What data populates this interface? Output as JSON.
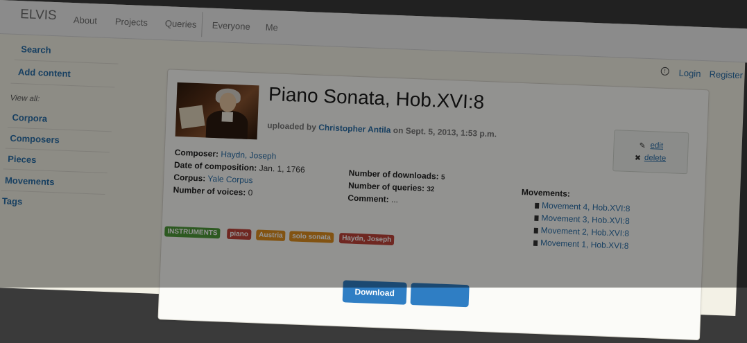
{
  "navbar": {
    "brand": "ELVIS",
    "links": [
      "About",
      "Projects",
      "Queries",
      "Everyone",
      "Me"
    ]
  },
  "sidebar": {
    "search": "Search",
    "add_content": "Add content",
    "view_all_heading": "View all:",
    "items": [
      "Corpora",
      "Composers",
      "Pieces",
      "Movements",
      "Tags"
    ]
  },
  "user_nav": {
    "icon": "user-circle-icon",
    "login": "Login",
    "register": "Register"
  },
  "piece": {
    "title": "Piano Sonata, Hob.XVI:8",
    "uploaded_prefix": "uploaded by",
    "uploader": "Christopher Antila",
    "uploaded_on": "on Sept. 5, 2013, 1:53 p.m.",
    "composer_label": "Composer:",
    "composer": "Haydn, Joseph",
    "date_label": "Date of composition:",
    "date": "Jan. 1, 1766",
    "corpus_label": "Corpus:",
    "corpus": "Yale Corpus",
    "voices_label": "Number of voices:",
    "voices": "0",
    "downloads_label": "Number of downloads:",
    "downloads": "5",
    "queries_label": "Number of queries:",
    "queries": "32",
    "comment_label": "Comment:",
    "comment": "...",
    "movements_label": "Movements:",
    "movements": [
      "Movement 4, Hob.XVI:8",
      "Movement 3, Hob.XVI:8",
      "Movement 2, Hob.XVI:8",
      "Movement 1, Hob.XVI:8"
    ]
  },
  "actions": {
    "edit": "edit",
    "delete": "delete",
    "edit_icon": "pencil-icon",
    "delete_icon": "x-icon"
  },
  "tags": [
    {
      "label": "INSTRUMENTS",
      "color": "#4e9a3a"
    },
    {
      "label": "piano",
      "color": "#c0443a"
    },
    {
      "label": "Austria",
      "color": "#e0901f"
    },
    {
      "label": "solo sonata",
      "color": "#e0901f"
    },
    {
      "label": "Haydn, Joseph",
      "color": "#c0443a"
    }
  ],
  "buttons": {
    "download": "Download"
  },
  "colors": {
    "link": "#2a6ea8",
    "button": "#2f7ec4",
    "page_background": "#f3f1e6"
  }
}
